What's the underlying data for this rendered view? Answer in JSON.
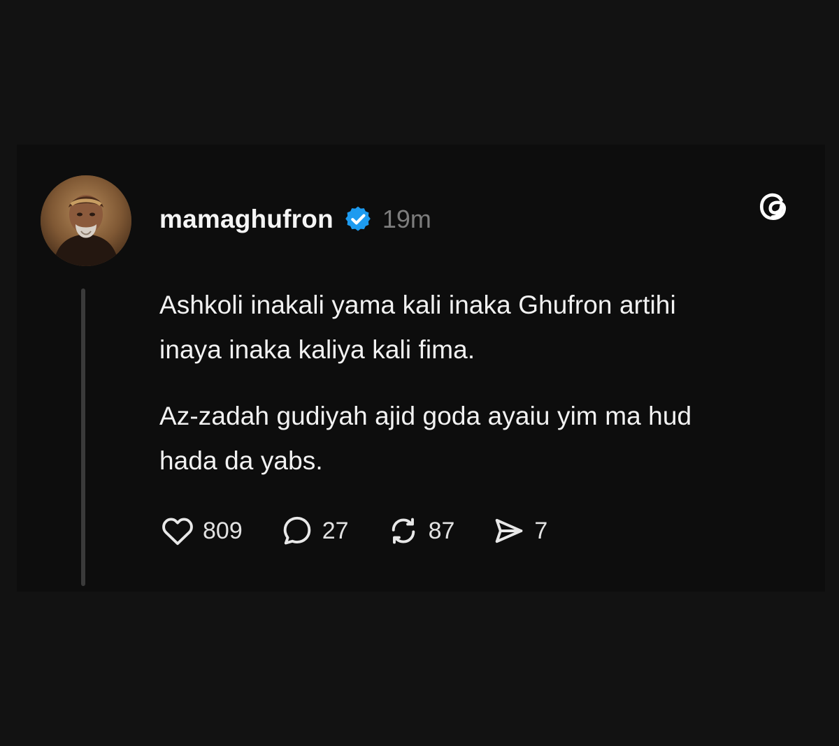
{
  "post": {
    "username": "mamaghufron",
    "verified": true,
    "timestamp": "19m",
    "paragraphs": [
      "Ashkoli inakali yama kali inaka Ghufron artihi inaya inaka kaliya kali fima.",
      "Az-zadah gudiyah ajid goda ayaiu yim ma hud hada da yabs."
    ]
  },
  "actions": {
    "likes": "809",
    "replies": "27",
    "reposts": "87",
    "shares": "7"
  },
  "icons": {
    "verified": "verified-badge-icon",
    "brand": "threads-logo-icon",
    "like": "heart-icon",
    "reply": "comment-icon",
    "repost": "repost-icon",
    "share": "send-icon"
  },
  "colors": {
    "background": "#121212",
    "card": "#0d0d0d",
    "verified": "#1d9bf0",
    "muted": "#7d7d7d"
  }
}
